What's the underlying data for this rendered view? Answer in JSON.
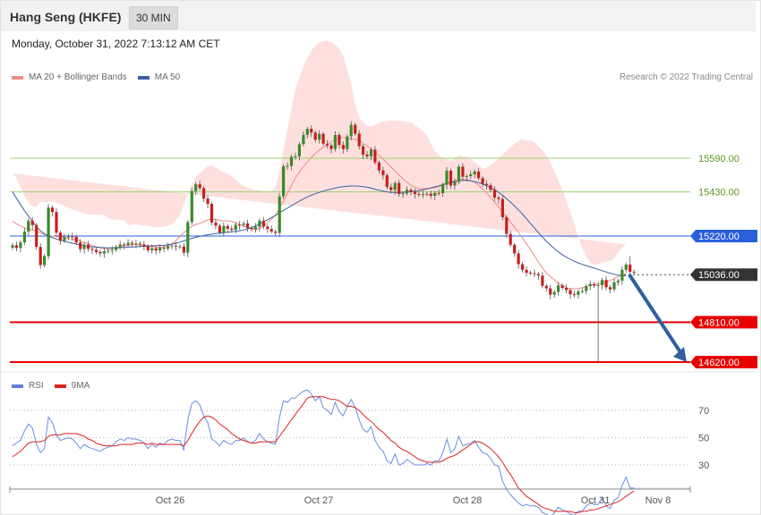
{
  "header": {
    "title": "Hang Seng (HKFE)",
    "timeframe": "30 MIN"
  },
  "timestamp": "Monday, October 31, 2022 7:13:12 AM CET",
  "legend_main": [
    {
      "label": "MA 20 + Bollinger Bands",
      "color": "#f28b82"
    },
    {
      "label": "MA 50",
      "color": "#3a5fa0"
    }
  ],
  "copyright": "Research © 2022 Trading Central",
  "legend_rsi": [
    {
      "label": "RSI",
      "color": "#5b7fd6"
    },
    {
      "label": "9MA",
      "color": "#e02020"
    }
  ],
  "colors": {
    "bull": "#3a8a2a",
    "bear": "#c81e1e",
    "resistance": "#9ccf6b",
    "pivot": "#2a5fdc",
    "support": "#e80000",
    "price_tag": "#333333",
    "arrow": "#2f5fa0",
    "band_fill": "#fde0de"
  },
  "chart_data": {
    "type": "candlestick",
    "price_scale": {
      "min": 14620,
      "max": 15590
    },
    "levels": [
      {
        "value": 15590,
        "label": "15590.00",
        "kind": "resistance"
      },
      {
        "value": 15430,
        "label": "15430.00",
        "kind": "resistance"
      },
      {
        "value": 15220,
        "label": "15220.00",
        "kind": "pivot"
      },
      {
        "value": 15036,
        "label": "15036.00",
        "kind": "last_price"
      },
      {
        "value": 14810,
        "label": "14810.00",
        "kind": "support"
      },
      {
        "value": 14620,
        "label": "14620.00",
        "kind": "support"
      }
    ],
    "x_labels": [
      "Oct 26",
      "Oct 27",
      "Oct 28",
      "Oct 31",
      "Nov 8"
    ],
    "closes": [
      15176,
      15163,
      15190,
      15241,
      15293,
      15272,
      15168,
      15082,
      15124,
      15355,
      15334,
      15236,
      15197,
      15214,
      15219,
      15216,
      15189,
      15158,
      15179,
      15159,
      15154,
      15144,
      15137,
      15148,
      15150,
      15154,
      15168,
      15180,
      15177,
      15188,
      15183,
      15184,
      15180,
      15171,
      15152,
      15162,
      15151,
      15164,
      15160,
      15171,
      15174,
      15170,
      15170,
      15141,
      15286,
      15434,
      15466,
      15448,
      15398,
      15373,
      15284,
      15269,
      15237,
      15268,
      15255,
      15249,
      15274,
      15273,
      15280,
      15258,
      15252,
      15264,
      15293,
      15265,
      15253,
      15241,
      15235,
      15408,
      15552,
      15554,
      15597,
      15599,
      15657,
      15701,
      15730,
      15712,
      15678,
      15706,
      15659,
      15651,
      15634,
      15701,
      15653,
      15634,
      15694,
      15749,
      15707,
      15647,
      15608,
      15599,
      15631,
      15570,
      15532,
      15509,
      15453,
      15439,
      15472,
      15420,
      15423,
      15440,
      15430,
      15420,
      15418,
      15419,
      15421,
      15411,
      15425,
      15424,
      15464,
      15531,
      15460,
      15478,
      15550,
      15502,
      15505,
      15513,
      15527,
      15495,
      15468,
      15462,
      15440,
      15403,
      15396,
      15309,
      15230,
      15178,
      15137,
      15086,
      15059,
      15045,
      15043,
      15039,
      15032,
      14983,
      14971,
      14941,
      14954,
      14985,
      14973,
      14963,
      14943,
      14940,
      14956,
      14958,
      14982,
      14992,
      14984,
      14986,
      15011,
      14976,
      14966,
      15000,
      15008,
      15059,
      15084,
      15050,
      15049
    ],
    "ma20": [
      15290,
      15278,
      15268,
      15260,
      15253,
      15248,
      15243,
      15236,
      15228,
      15223,
      15220,
      15217,
      15216,
      15214,
      15209,
      15206,
      15202,
      15196,
      15190,
      15183,
      15176,
      15168,
      15163,
      15159,
      15158,
      15160,
      15164,
      15169,
      15174,
      15176,
      15179,
      15180,
      15177,
      15176,
      15173,
      15170,
      15167,
      15166,
      15169,
      15173,
      15182,
      15198,
      15218,
      15235,
      15252,
      15266,
      15275,
      15280,
      15288,
      15297,
      15301,
      15298,
      15294,
      15292,
      15292,
      15289,
      15284,
      15274,
      15268,
      15262,
      15255,
      15251,
      15256,
      15266,
      15282,
      15301,
      15320,
      15352,
      15386,
      15422,
      15460,
      15497,
      15525,
      15549,
      15572,
      15593,
      15613,
      15629,
      15642,
      15656,
      15669,
      15678,
      15686,
      15689,
      15684,
      15683,
      15680,
      15675,
      15662,
      15648,
      15634,
      15620,
      15603,
      15586,
      15567,
      15548,
      15530,
      15511,
      15492,
      15476,
      15461,
      15452,
      15444,
      15444,
      15446,
      15448,
      15450,
      15454,
      15463,
      15469,
      15476,
      15485,
      15491,
      15489,
      15489,
      15484,
      15476,
      15462,
      15443,
      15425,
      15402,
      15381,
      15358,
      15334,
      15311,
      15287,
      15263,
      15237,
      15210,
      15183,
      15155,
      15126,
      15096,
      15068,
      15043,
      15027,
      15012,
      14995,
      14984,
      14975,
      14969,
      14969,
      14970,
      14974,
      14979,
      14985,
      14987,
      14992,
      14996,
      15003,
      15008,
      15017,
      15027,
      15035,
      15042
    ],
    "ma50": [
      15430,
      15400,
      15370,
      15340,
      15315,
      15290,
      15265,
      15245,
      15230,
      15220,
      15212,
      15206,
      15200,
      15195,
      15190,
      15186,
      15182,
      15178,
      15174,
      15171,
      15169,
      15167,
      15166,
      15165,
      15164,
      15164,
      15164,
      15165,
      15166,
      15167,
      15168,
      15169,
      15170,
      15171,
      15172,
      15173,
      15174,
      15175,
      15176,
      15178,
      15181,
      15186,
      15191,
      15197,
      15203,
      15209,
      15214,
      15218,
      15222,
      15226,
      15229,
      15232,
      15234,
      15236,
      15238,
      15240,
      15242,
      15245,
      15249,
      15254,
      15260,
      15268,
      15277,
      15287,
      15297,
      15307,
      15318,
      15330,
      15342,
      15353,
      15364,
      15375,
      15386,
      15397,
      15406,
      15414,
      15421,
      15428,
      15434,
      15439,
      15444,
      15448,
      15452,
      15455,
      15457,
      15458,
      15458,
      15457,
      15455,
      15452,
      15448,
      15443,
      15438,
      15434,
      15430,
      15428,
      15427,
      15427,
      15428,
      15429,
      15431,
      15433,
      15436,
      15440,
      15444,
      15449,
      15454,
      15459,
      15465,
      15470,
      15475,
      15479,
      15482,
      15484,
      15484,
      15483,
      15479,
      15474,
      15467,
      15459,
      15450,
      15440,
      15428,
      15414,
      15398,
      15381,
      15363,
      15344,
      15324,
      15302,
      15280,
      15258,
      15236,
      15215,
      15195,
      15177,
      15160,
      15145,
      15131,
      15119,
      15109,
      15100,
      15092,
      15085,
      15079,
      15073,
      15067,
      15061,
      15055,
      15049,
      15043,
      15038,
      15034,
      15032,
      15031
    ],
    "forecast": {
      "from": 15036,
      "to": 14620
    },
    "rsi": {
      "levels": [
        70,
        50,
        30
      ],
      "rsi": [
        44,
        46,
        48,
        55,
        60,
        57,
        45,
        39,
        42,
        65,
        61,
        52,
        48,
        49,
        50,
        49,
        46,
        42,
        45,
        43,
        42,
        41,
        40,
        42,
        43,
        44,
        47,
        49,
        48,
        50,
        49,
        49,
        48,
        46,
        42,
        45,
        43,
        46,
        45,
        48,
        49,
        48,
        48,
        41,
        63,
        75,
        77,
        74,
        66,
        61,
        49,
        47,
        44,
        48,
        46,
        45,
        48,
        48,
        50,
        47,
        46,
        48,
        53,
        49,
        47,
        46,
        45,
        65,
        77,
        76,
        79,
        79,
        82,
        84,
        85,
        82,
        77,
        80,
        72,
        70,
        67,
        76,
        69,
        66,
        73,
        78,
        72,
        63,
        56,
        54,
        58,
        48,
        43,
        40,
        33,
        31,
        38,
        30,
        31,
        34,
        32,
        30,
        30,
        30,
        31,
        30,
        33,
        33,
        39,
        49,
        39,
        42,
        51,
        44,
        45,
        46,
        48,
        43,
        39,
        38,
        35,
        30,
        29,
        18,
        12,
        8,
        5,
        2,
        0,
        1,
        0,
        0,
        -1,
        -5,
        -6,
        -8,
        -5,
        -1,
        -3,
        -4,
        -6,
        -7,
        -4,
        -4,
        0,
        2,
        1,
        1,
        6,
        0,
        -2,
        4,
        6,
        15,
        21,
        13,
        13
      ],
      "ma9": [
        36,
        38,
        40,
        43,
        46,
        47,
        47,
        47,
        48,
        51,
        52,
        52,
        52,
        53,
        53,
        53,
        53,
        52,
        51,
        49,
        48,
        46,
        45,
        44,
        44,
        44,
        44,
        45,
        45,
        45,
        45,
        46,
        46,
        46,
        45,
        46,
        45,
        45,
        45,
        45,
        45,
        45,
        45,
        44,
        48,
        53,
        58,
        62,
        65,
        66,
        65,
        63,
        60,
        58,
        56,
        53,
        51,
        49,
        48,
        47,
        46,
        46,
        47,
        47,
        47,
        47,
        47,
        51,
        55,
        59,
        63,
        67,
        71,
        75,
        79,
        80,
        80,
        80,
        80,
        79,
        78,
        78,
        77,
        75,
        73,
        73,
        72,
        70,
        67,
        64,
        62,
        59,
        56,
        54,
        51,
        48,
        46,
        43,
        41,
        40,
        38,
        36,
        34,
        33,
        32,
        32,
        32,
        32,
        33,
        35,
        36,
        37,
        39,
        41,
        43,
        45,
        47,
        47,
        46,
        44,
        42,
        39,
        36,
        32,
        27,
        23,
        18,
        13,
        10,
        7,
        5,
        3,
        1,
        -1,
        -2,
        -3,
        -4,
        -4,
        -4,
        -4,
        -4,
        -5,
        -5,
        -4,
        -4,
        -3,
        -3,
        -2,
        -1,
        0,
        1,
        2,
        3,
        5,
        7,
        9,
        11
      ]
    }
  }
}
